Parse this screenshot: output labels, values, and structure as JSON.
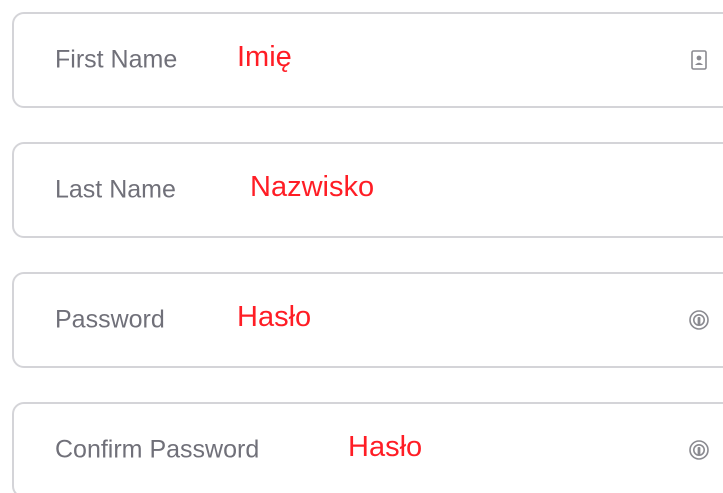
{
  "form": {
    "fields": [
      {
        "placeholder": "First Name",
        "annotation": "Imię",
        "icon": "contact-card-icon"
      },
      {
        "placeholder": "Last Name",
        "annotation": "Nazwisko",
        "icon": null
      },
      {
        "placeholder": "Password",
        "annotation": "Hasło",
        "icon": "password-key-icon"
      },
      {
        "placeholder": "Confirm Password",
        "annotation": "Hasło",
        "icon": "password-key-icon"
      }
    ]
  },
  "colors": {
    "annotation": "#ff1d25",
    "placeholder": "#707079",
    "border": "#d4d4d8",
    "icon": "#8a8a90"
  }
}
